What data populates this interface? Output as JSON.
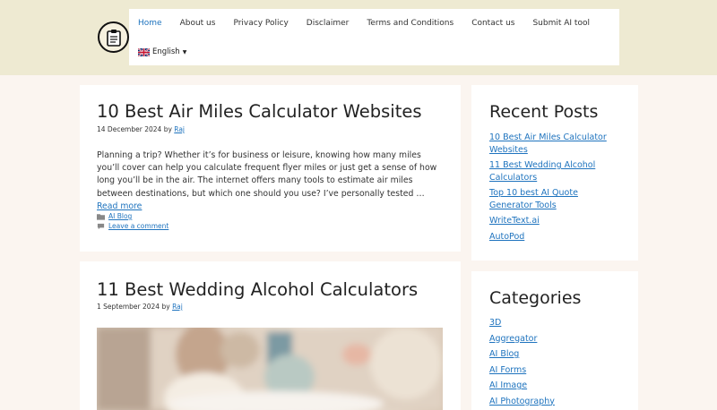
{
  "header": {
    "nav": [
      {
        "label": "Home",
        "active": true
      },
      {
        "label": "About us"
      },
      {
        "label": "Privacy Policy"
      },
      {
        "label": "Disclaimer"
      },
      {
        "label": "Terms and Conditions"
      },
      {
        "label": "Contact us"
      },
      {
        "label": "Submit AI tool"
      }
    ],
    "language": "English"
  },
  "posts": [
    {
      "title": "10 Best Air Miles Calculator Websites",
      "date": "14 December 2024",
      "by": "by",
      "author": "Raj",
      "excerpt": "Planning a trip? Whether it’s for business or leisure, knowing how many miles you’ll cover can help you calculate frequent flyer miles or just get a sense of how long you’ll be in the air. The internet offers many tools to estimate air miles between destinations, but which one should you use? I’ve personally tested …",
      "read_more": "Read more",
      "category": "AI Blog",
      "comment": "Leave a comment"
    },
    {
      "title": "11 Best Wedding Alcohol Calculators",
      "date": "1 September 2024",
      "by": "by",
      "author": "Raj"
    }
  ],
  "sidebar": {
    "recent_title": "Recent Posts",
    "recent": [
      "10 Best Air Miles Calculator Websites",
      "11 Best Wedding Alcohol Calculators",
      "Top 10 best AI Quote Generator Tools",
      "WriteText.ai",
      "AutoPod"
    ],
    "categories_title": "Categories",
    "categories": [
      "3D",
      "Aggregator",
      "AI Blog",
      "AI Forms",
      "AI Image",
      "AI Photography"
    ]
  },
  "colors": {
    "header_bg": "#eeead2",
    "page_bg": "#fbf5f0",
    "link": "#1e73be"
  }
}
